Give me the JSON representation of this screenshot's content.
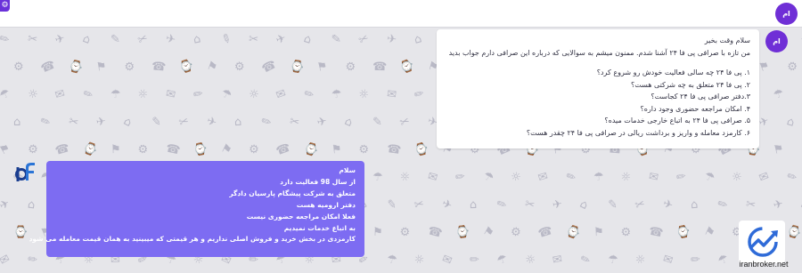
{
  "header": {
    "settings_icon": "gear-icon",
    "user_avatar": "ام"
  },
  "chat": {
    "incoming": {
      "avatar": "ام",
      "lines": [
        "سلام وقت بخیر",
        "من تازه با صرافی پی فا ۲۴ آشنا شدم. ممنون میشم به سوالایی که درباره این صرافی دارم جواب بدید",
        "",
        "۱. پی فا ۲۴ چه سالی فعالیت خودش رو شروع کرد؟",
        "۲. پی فا ۲۴ متعلق به چه شرکتی هست؟",
        "۳.دفتر صرافی پی فا ۲۴ کجاست؟",
        "۴. امکان مراجعه حضوری وجود داره؟",
        "۵. صرافی پی فا ۲۴ به اتباع خارجی خدمات میده؟",
        "۶. کارمزد معامله و واریز و برداشت ریالی در صرافی پی فا ۲۴ چقدر هست؟"
      ]
    },
    "outgoing": {
      "logo": "pf-logo",
      "lines": [
        "سلام",
        "از سال 98 فعالیت دارد",
        "متعلق به شرکت پیشگام پارسیان دادگر",
        "دفتر ارومیه هست",
        "فعلا امکان مراجعه حضوری نیست",
        "به اتباع خدمات نمیدیم",
        "کارمزدی در بخش خرید و فروش اصلی نداریم و هر قیمتی که میبینید به همان قیمت معامله می شود"
      ]
    }
  },
  "watermark": {
    "site": "iranbroker.net"
  },
  "colors": {
    "accent": "#6f2fd6",
    "reply_bubble": "#7d6cf2",
    "background": "#e6e6ea"
  }
}
